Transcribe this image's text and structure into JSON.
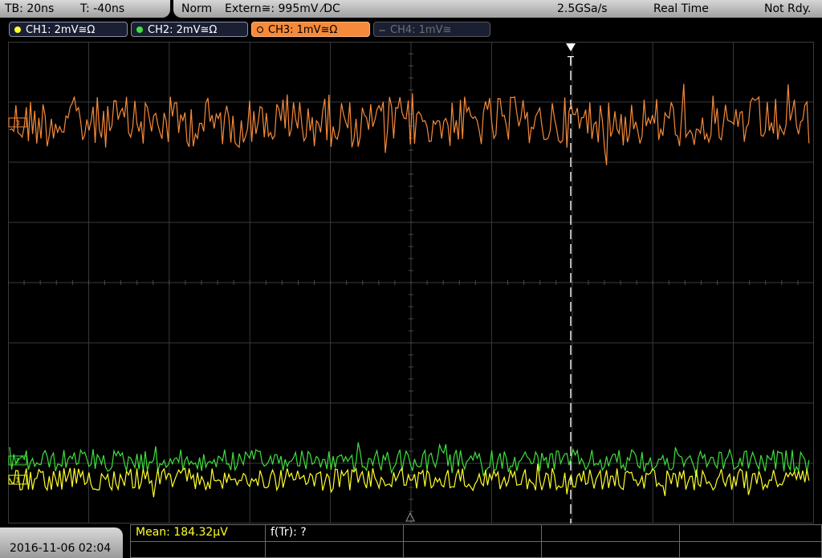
{
  "topbar": {
    "timebase": "TB: 20ns",
    "trigger_time": "T: -40ns",
    "trigger_mode": "Norm",
    "trigger_source": "Extern≅: 995mV ⁄DC",
    "sample_rate": "2.5GSa/s",
    "acq_mode": "Real Time",
    "status": "Not Rdy."
  },
  "channels": [
    {
      "label": "CH1: 2mV≅Ω",
      "color": "#ffff2a",
      "active": true
    },
    {
      "label": "CH2: 2mV≅Ω",
      "color": "#3ee03e",
      "active": true
    },
    {
      "label": "CH3: 1mV≅Ω",
      "color": "#f58a3a",
      "active": true,
      "selected": true
    },
    {
      "label": "CH4: 1mV≅",
      "color": "#555555",
      "active": false
    }
  ],
  "markers": {
    "trigger": "T",
    "ch3_ref": "3",
    "ch2_ref": "2",
    "ch1_ref": "1"
  },
  "bottom": {
    "datetime": "2016-11-06 02:04",
    "measurement_1": "Mean: 184.32µV",
    "measurement_2": "f(Tr): ?"
  },
  "colors": {
    "ch1": "#ffff2a",
    "ch2": "#3ee03e",
    "ch3": "#f58a3a",
    "grid": "#3a3a3a",
    "mean_text": "#ffff2a"
  }
}
